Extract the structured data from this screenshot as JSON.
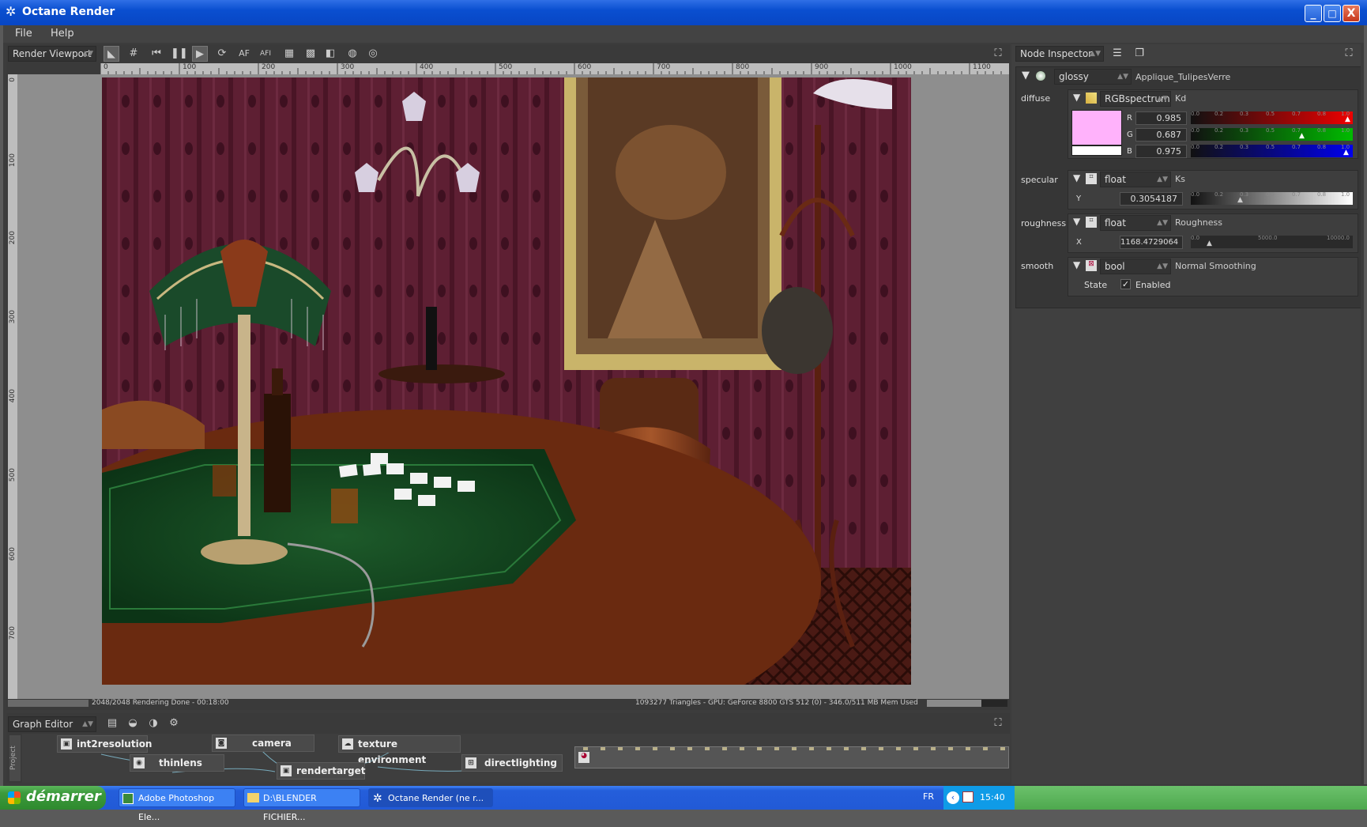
{
  "window": {
    "title": "Octane Render",
    "icon": "octane-star-icon",
    "buttons": {
      "minimize": "_",
      "maximize": "□",
      "close": "X"
    }
  },
  "menu": {
    "file": "File",
    "help": "Help"
  },
  "viewport": {
    "selector": "Render Viewport",
    "tools": [
      "select-icon",
      "grid-icon",
      "rewind-icon",
      "pause-icon",
      "play-icon",
      "refresh-icon",
      "af-icon",
      "afi-icon",
      "frame-icon",
      "checker-icon",
      "split-icon",
      "globe-icon",
      "globe2-icon"
    ],
    "af_label": "AF",
    "afi_label": "AFI",
    "ruler_top": [
      "0",
      "100",
      "200",
      "300",
      "400",
      "500",
      "600",
      "700",
      "800",
      "900",
      "1000",
      "1100"
    ],
    "ruler_left": [
      "0",
      "100",
      "200",
      "300",
      "400",
      "500",
      "600",
      "700"
    ],
    "status_left": "2048/2048 Rendering Done - 00:18:00",
    "status_right": "1093277 Triangles - GPU: GeForce 8800 GTS 512 (0) - 346.0/511 MB Mem Used",
    "progress": 1.0,
    "mem_fraction": 0.68
  },
  "inspector": {
    "title": "Node Inspector",
    "material_type": "glossy",
    "material_name": "Applique_TulipesVerre",
    "diffuse": {
      "label": "diffuse",
      "node": "RGBspectrum",
      "pin": "Kd",
      "swatch": "#ffb2fb",
      "r_label": "R",
      "r": "0.985",
      "g_label": "G",
      "g": "0.687",
      "b_label": "B",
      "b": "0.975",
      "ticks": [
        "0.0",
        "0.2",
        "0.3",
        "0.5",
        "0.7",
        "0.8",
        "1.0"
      ]
    },
    "specular": {
      "label": "specular",
      "node": "float",
      "pin": "Ks",
      "axis": "Y",
      "value": "0.3054187",
      "fraction": 0.3054187,
      "ticks": [
        "0.0",
        "0.2",
        "0.3",
        "0.5",
        "0.7",
        "0.8",
        "1.0"
      ]
    },
    "roughness": {
      "label": "roughness",
      "node": "float",
      "pin": "Roughness",
      "axis": "X",
      "value": "1168.4729064",
      "fraction": 0.117,
      "ticks": [
        "0.0",
        "5000.0",
        "10000.0"
      ]
    },
    "smooth": {
      "label": "smooth",
      "node": "bool",
      "pin": "Normal Smoothing",
      "state_label": "State",
      "checkbox_label": "Enabled",
      "checked": true
    }
  },
  "graph": {
    "title": "Graph Editor",
    "side_tab": "Project",
    "nodes": {
      "int2resolution": "int2resolution",
      "camera": "camera",
      "texture_environment": "texture environment",
      "thinlens": "thinlens",
      "rendertarget": "rendertarget",
      "directlighting": "directlighting"
    }
  },
  "taskbar": {
    "start": "démarrer",
    "tasks": [
      "Adobe Photoshop Ele...",
      "D:\\BLENDER FICHIER...",
      "Octane Render (ne r..."
    ],
    "lang": "FR",
    "clock": "15:40"
  }
}
